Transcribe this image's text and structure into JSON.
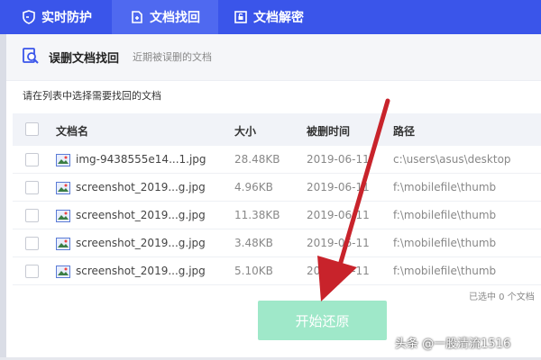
{
  "tabs": [
    {
      "label": "实时防护",
      "icon": "shield-icon"
    },
    {
      "label": "文档找回",
      "icon": "document-restore-icon",
      "active": true
    },
    {
      "label": "文档解密",
      "icon": "document-unlock-icon"
    }
  ],
  "section": {
    "title": "误删文档找回",
    "subtitle": "近期被误删的文档",
    "icon": "search-document-icon"
  },
  "instruction": "请在列表中选择需要找回的文档",
  "table": {
    "columns": [
      "文档名",
      "大小",
      "被删时间",
      "路径"
    ],
    "rows": [
      {
        "name": "img-9438555e14...1.jpg",
        "size": "28.48KB",
        "time": "2019-06-11",
        "path": "c:\\users\\asus\\desktop"
      },
      {
        "name": "screenshot_2019...g.jpg",
        "size": "4.96KB",
        "time": "2019-06-11",
        "path": "f:\\mobilefile\\thumb"
      },
      {
        "name": "screenshot_2019...g.jpg",
        "size": "11.38KB",
        "time": "2019-06-11",
        "path": "f:\\mobilefile\\thumb"
      },
      {
        "name": "screenshot_2019...g.jpg",
        "size": "3.48KB",
        "time": "2019-06-11",
        "path": "f:\\mobilefile\\thumb"
      },
      {
        "name": "screenshot_2019...g.jpg",
        "size": "5.10KB",
        "time": "2019-06-11",
        "path": "f:\\mobilefile\\thumb"
      }
    ]
  },
  "selected_info": "已选中 0 个文档",
  "start_button": "开始还原",
  "watermark": "头条 @一股清流1516",
  "colors": {
    "topbar": "#3a55ea",
    "active_tab": "#4f69f0",
    "start_button": "#9fe8c9",
    "arrow": "#c8232b"
  }
}
